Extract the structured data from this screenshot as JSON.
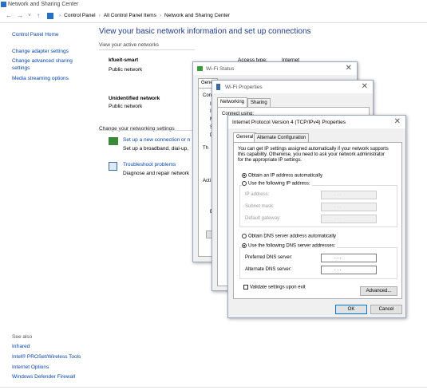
{
  "window": {
    "title": "Network and Sharing Center"
  },
  "address": {
    "crumbs": [
      "Control Panel",
      "All Control Panel Items",
      "Network and Sharing Center"
    ]
  },
  "left": {
    "home": "Control Panel Home",
    "links": [
      "Change adapter settings",
      "Change advanced sharing",
      "settings",
      "Media streaming options"
    ],
    "see_also": "See also",
    "see_links": [
      "Infrared",
      "Intel® PROSet/Wireless Tools",
      "Internet Options",
      "Windows Defender Firewall"
    ]
  },
  "main": {
    "heading": "View your basic network information and set up connections",
    "active_networks": "View your active networks",
    "networks": [
      {
        "name": "kfueit-smart",
        "type": "Public network",
        "access_label": "Access type:",
        "access_value": "Internet"
      },
      {
        "name": "Unidentified network",
        "type": "Public network"
      }
    ],
    "change_settings": "Change your networking settings",
    "tasks": [
      {
        "link": "Set up a new connection or n",
        "desc": "Set up a broadband, dial-up,"
      },
      {
        "link": "Troubleshoot problems",
        "desc": "Diagnose and repair network"
      }
    ]
  },
  "wifi_status": {
    "title": "Wi-Fi Status",
    "tab": "Gener",
    "frag": [
      "Conn",
      "IP",
      "IP",
      "M",
      "S",
      "D"
    ],
    "frag2": [
      "Th",
      "Acti",
      "B"
    ]
  },
  "wifi_props": {
    "title": "Wi-Fi Properties",
    "tabs": [
      "Networking",
      "Sharing"
    ],
    "frag": "Connect using:"
  },
  "ipv4": {
    "title": "Internet Protocol Version 4 (TCP/IPv4) Properties",
    "tabs": [
      "General",
      "Alternate Configuration"
    ],
    "intro": [
      "You can get IP settings assigned automatically if your network supports",
      "this capability. Otherwise, you need to ask your network administrator",
      "for the appropriate IP settings."
    ],
    "auto_ip": "Obtain an IP address automatically",
    "use_ip": "Use the following IP address:",
    "ip_fields": [
      "IP address:",
      "Subnet mask:",
      "Default gateway:"
    ],
    "auto_dns": "Obtain DNS server address automatically",
    "use_dns": "Use the following DNS server addresses:",
    "dns_fields": [
      "Preferred DNS server:",
      "Alternate DNS server:"
    ],
    "ip_dots": ". . .",
    "validate": "Validate settings upon exit",
    "advanced": "Advanced...",
    "ok": "OK",
    "cancel": "Cancel"
  }
}
